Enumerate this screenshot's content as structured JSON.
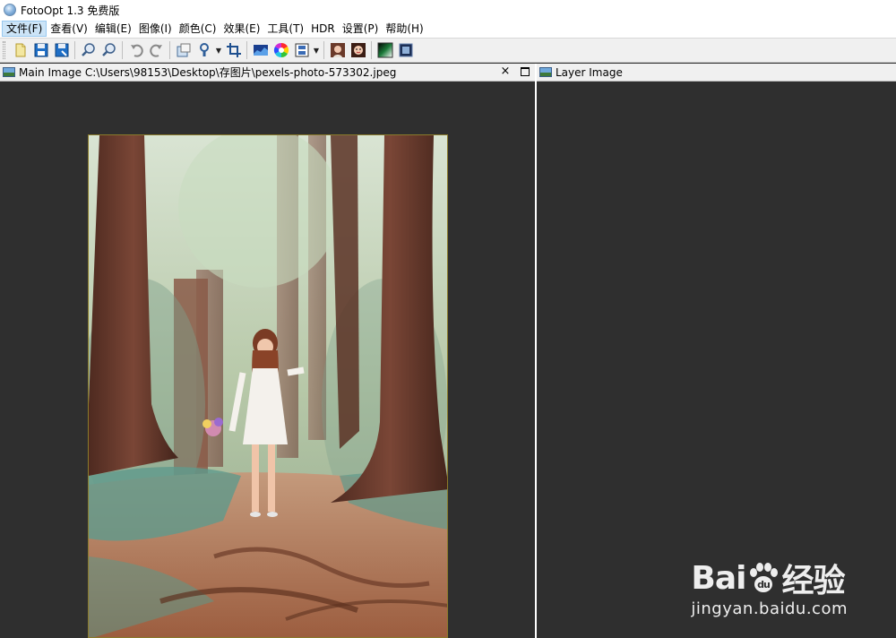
{
  "window": {
    "title": "FotoOpt 1.3 免费版"
  },
  "menu": [
    {
      "label": "文件(F)",
      "active": true
    },
    {
      "label": "查看(V)"
    },
    {
      "label": "编辑(E)"
    },
    {
      "label": "图像(I)"
    },
    {
      "label": "颜色(C)"
    },
    {
      "label": "效果(E)"
    },
    {
      "label": "工具(T)"
    },
    {
      "label": "HDR"
    },
    {
      "label": "设置(P)"
    },
    {
      "label": "帮助(H)"
    }
  ],
  "toolbar": {
    "icons": [
      "open-icon",
      "save-icon",
      "save-as-icon",
      "zoom-in-icon",
      "zoom-out-icon",
      "undo-icon",
      "redo-icon",
      "resize-icon",
      "brush-icon",
      "crop-icon",
      "levels-icon",
      "color-wheel-icon",
      "film-icon",
      "portrait-icon",
      "face-icon",
      "gradient-icon",
      "frame-icon"
    ]
  },
  "main_pane": {
    "title": "Main Image C:\\Users\\98153\\Desktop\\存图片\\pexels-photo-573302.jpeg",
    "close_glyph": "×"
  },
  "layer_pane": {
    "title": "Layer Image"
  },
  "watermark": {
    "brand_prefix": "Bai",
    "brand_suffix": "经验",
    "url": "jingyan.baidu.com"
  },
  "colors": {
    "canvas": "#2f2f2f",
    "menu_active": "#cce4f7",
    "toolbar": "#f0f0f0"
  }
}
